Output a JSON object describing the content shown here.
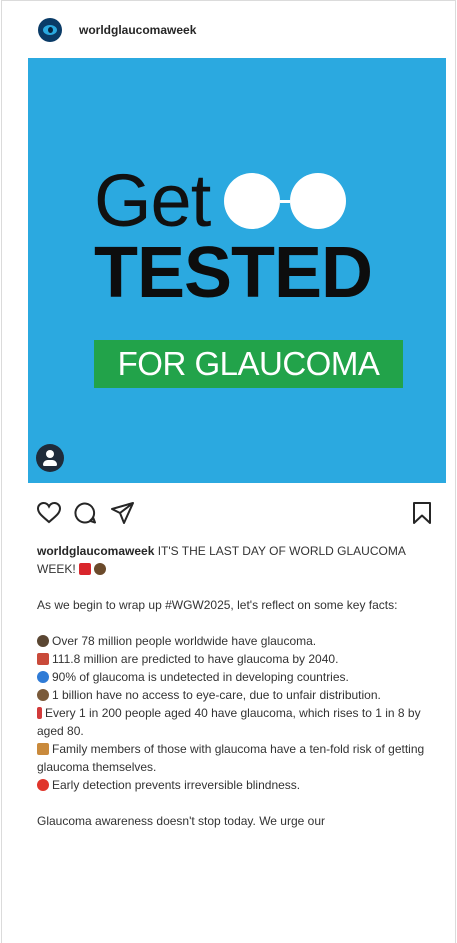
{
  "header": {
    "username": "worldglaucomaweek"
  },
  "image": {
    "line1": "Get",
    "line2": "TESTED",
    "banner": "FOR GLAUCOMA",
    "colors": {
      "background": "#2ba9e0",
      "banner": "#22a34a",
      "text": "#111111"
    }
  },
  "actions": [
    "heart-icon",
    "comment-icon",
    "share-icon",
    "bookmark-icon"
  ],
  "caption": {
    "username": "worldglaucomaweek",
    "intro": "IT'S THE LAST DAY OF WORLD GLAUCOMA WEEK!",
    "para1": "As we begin to wrap up #WGW2025, let's reflect on some key facts:",
    "facts": [
      "Over 78 million people worldwide have glaucoma.",
      "111.8 million are predicted to have glaucoma by 2040.",
      "90% of glaucoma is undetected in developing countries.",
      "1 billion have no access to eye-care, due to unfair distribution.",
      "Every 1 in 200 people aged 40 have glaucoma, which rises to 1 in 8 by aged 80.",
      "Family members of those with glaucoma have a ten-fold risk of getting glaucoma themselves.",
      "Early detection prevents irreversible blindness."
    ],
    "closing": "Glaucoma awareness doesn't stop today. We urge our"
  }
}
